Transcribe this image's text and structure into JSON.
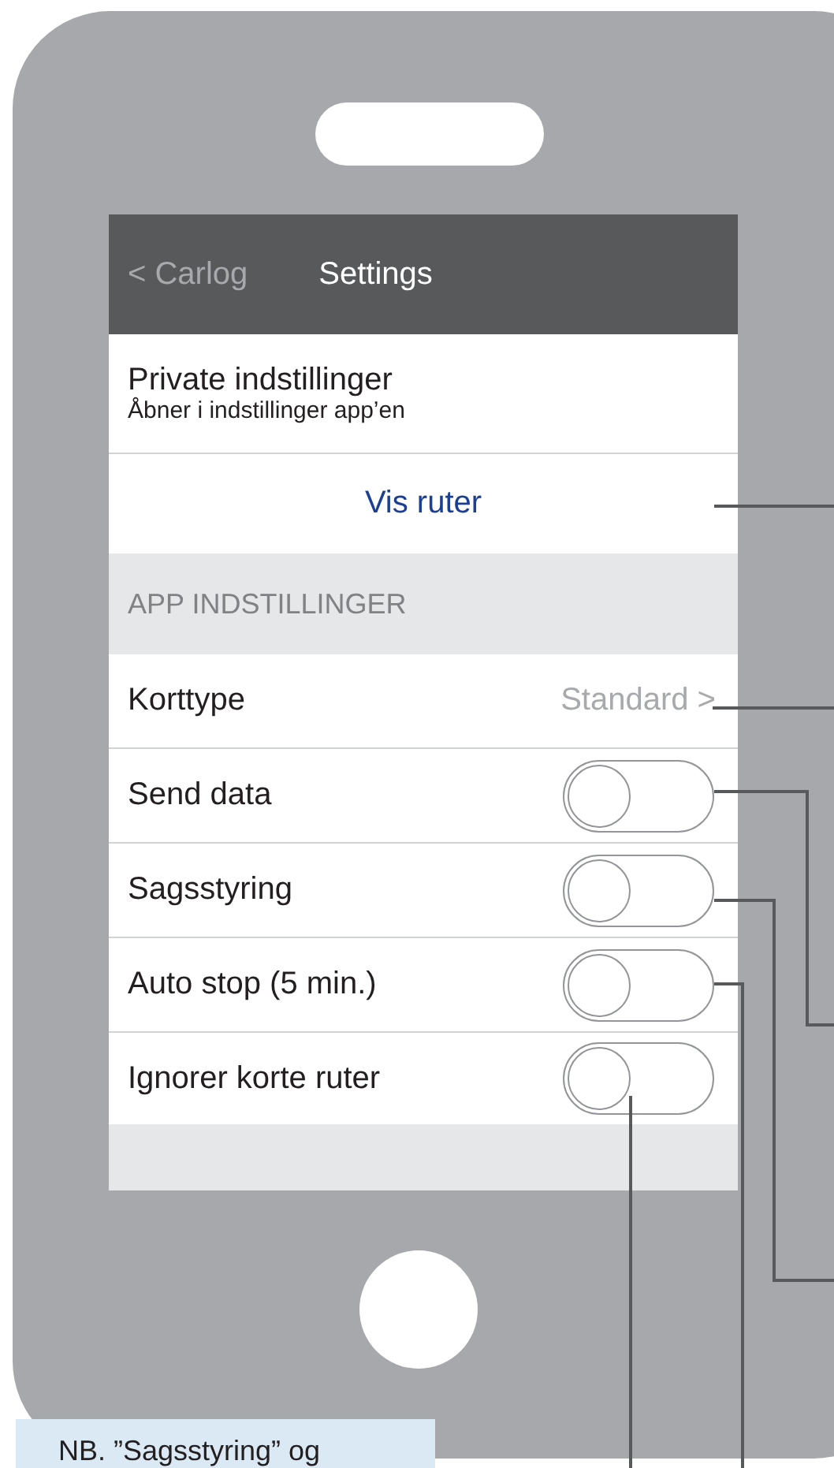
{
  "nav_bar": {
    "back": "< Carlog",
    "title": "Settings"
  },
  "private_settings": {
    "title": "Private indstillinger",
    "subtitle": "Åbner i indstillinger app’en"
  },
  "link_button": "Vis ruter",
  "section_header": "APP INDSTILLINGER",
  "rows": [
    {
      "kind": "value",
      "label": "Korttype",
      "value": "Standard >"
    },
    {
      "kind": "toggle",
      "label": "Send data",
      "on": false
    },
    {
      "kind": "toggle",
      "label": "Sagsstyring",
      "on": false
    },
    {
      "kind": "toggle",
      "label": "Auto stop (5 min.)",
      "on": false
    },
    {
      "kind": "toggle",
      "label": "Ignorer korte ruter",
      "on": false
    }
  ],
  "note": "NB. ”Sagsstyring” og"
}
